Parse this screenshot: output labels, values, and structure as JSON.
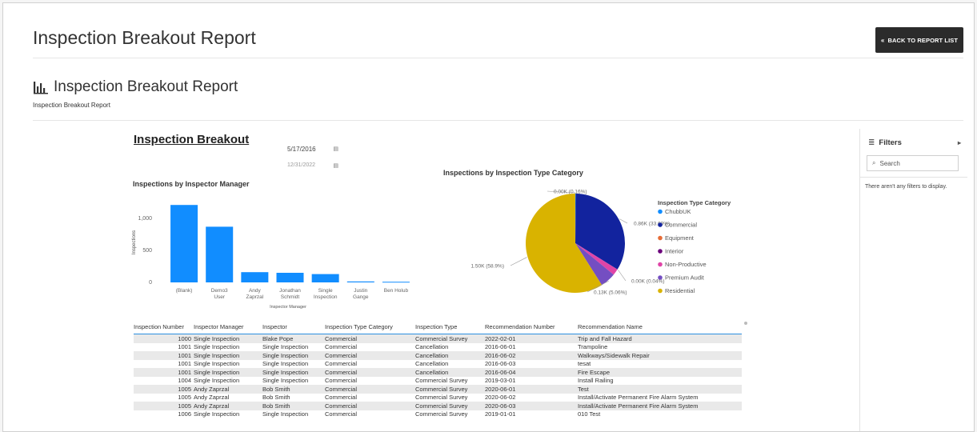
{
  "header": {
    "title": "Inspection Breakout Report",
    "back_label": "BACK TO REPORT LIST",
    "back_icon": "double-chevron-left-icon"
  },
  "report_header": {
    "title": "Inspection Breakout Report",
    "icon": "bar-chart-icon",
    "caption": "Inspection Breakout Report"
  },
  "report": {
    "title": "Inspection Breakout",
    "date_start": "5/17/2016",
    "date_end": "12/31/2022"
  },
  "bar_chart": {
    "title": "Inspections by Inspector Manager",
    "chart_data": {
      "type": "bar",
      "title": "Inspections by Inspector Manager",
      "xlabel": "Inspector Manager",
      "ylabel": "Inspections",
      "categories": [
        [
          "(Blank)"
        ],
        [
          "Demo3",
          "User"
        ],
        [
          "Andy",
          "Zaprzal"
        ],
        [
          "Jonathan",
          "Schmidt"
        ],
        [
          "Single",
          "Inspection"
        ],
        [
          "Justin",
          "Gange"
        ],
        [
          "Ben Holub"
        ]
      ],
      "values": [
        1210,
        870,
        160,
        150,
        130,
        15,
        10
      ],
      "ylim": [
        0,
        1250
      ],
      "yticks": [
        "0",
        "500",
        "1,000"
      ],
      "color": "#118dff"
    }
  },
  "pie_chart": {
    "title": "Inspections by Inspection Type Category",
    "chart_data": {
      "type": "pie",
      "title": "Inspections by Inspection Type Category",
      "legend_title": "Inspection Type Category",
      "slices": [
        {
          "name": "ChubbUK",
          "value": 0.0,
          "percent": 0.16,
          "label": "0.00K (0.16%)",
          "color": "#118dff"
        },
        {
          "name": "Commercial",
          "value": 0.86,
          "percent": 33.69,
          "label": "0.86K (33.69%)",
          "color": "#12239e"
        },
        {
          "name": "Equipment",
          "value": 0.0,
          "percent": 0.02,
          "label": "",
          "color": "#e66c37"
        },
        {
          "name": "Interior",
          "value": 0.0,
          "percent": 0.04,
          "label": "0.00K (0.04%)",
          "color": "#6b007b"
        },
        {
          "name": "Non-Productive",
          "value": 0.05,
          "percent": 2.04,
          "label": "",
          "color": "#e044a7"
        },
        {
          "name": "Premium Audit",
          "value": 0.13,
          "percent": 5.06,
          "label": "0.13K (5.06%)",
          "color": "#744ec2"
        },
        {
          "name": "Residential",
          "value": 1.5,
          "percent": 58.99,
          "label": "1.50K (58.9%)",
          "color": "#d9b300"
        }
      ]
    }
  },
  "table": {
    "headers": [
      "Inspection Number",
      "Inspector Manager",
      "Inspector",
      "Inspection Type Category",
      "Inspection Type",
      "Recommendation Number",
      "Recommendation Name"
    ],
    "rows": [
      [
        "1000",
        "Single Inspection",
        "Blake Pope",
        "Commercial",
        "Commercial Survey",
        "2022-02-01",
        "Trip and Fall Hazard"
      ],
      [
        "1001",
        "Single Inspection",
        "Single Inspection",
        "Commercial",
        "Cancellation",
        "2016-06-01",
        "Trampoline"
      ],
      [
        "1001",
        "Single Inspection",
        "Single Inspection",
        "Commercial",
        "Cancellation",
        "2016-06-02",
        "Walkways/Sidewalk Repair"
      ],
      [
        "1001",
        "Single Inspection",
        "Single Inspection",
        "Commercial",
        "Cancellation",
        "2016-06-03",
        "tesat"
      ],
      [
        "1001",
        "Single Inspection",
        "Single Inspection",
        "Commercial",
        "Cancellation",
        "2016-06-04",
        "Fire Escape"
      ],
      [
        "1004",
        "Single Inspection",
        "Single Inspection",
        "Commercial",
        "Commercial Survey",
        "2019-03-01",
        "Install Railing"
      ],
      [
        "1005",
        "Andy Zaprzal",
        "Bob Smith",
        "Commercial",
        "Commercial Survey",
        "2020-06-01",
        "Test"
      ],
      [
        "1005",
        "Andy Zaprzal",
        "Bob Smith",
        "Commercial",
        "Commercial Survey",
        "2020-06-02",
        "Install/Activate Permanent Fire Alarm System"
      ],
      [
        "1005",
        "Andy Zaprzal",
        "Bob Smith",
        "Commercial",
        "Commercial Survey",
        "2020-06-03",
        "Install/Activate Permanent Fire Alarm System"
      ],
      [
        "1006",
        "Single Inspection",
        "Single Inspection",
        "Commercial",
        "Commercial Survey",
        "2019-01-01",
        "010 Test"
      ]
    ]
  },
  "filters": {
    "title": "Filters",
    "search_placeholder": "Search",
    "empty_text": "There aren't any filters to display."
  }
}
